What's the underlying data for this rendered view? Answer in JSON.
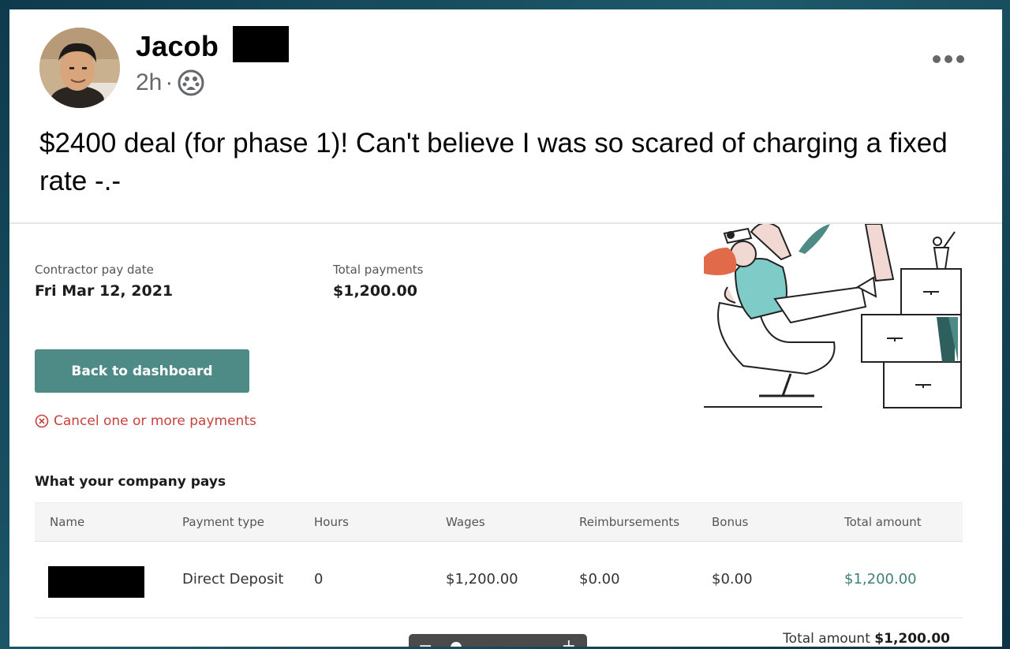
{
  "post": {
    "author": "Jacob",
    "time": "2h",
    "separator": "·",
    "audience_icon": "group-icon",
    "text": "$2400 deal (for phase 1)! Can't believe I was so scared of charging a fixed rate -.-"
  },
  "payment": {
    "pay_date_label": "Contractor pay date",
    "pay_date": "Fri Mar 12, 2021",
    "total_label": "Total payments",
    "total_value": "$1,200.00",
    "back_button": "Back to dashboard",
    "cancel_link": "Cancel one or more payments",
    "section_title": "What your company pays",
    "columns": [
      "Name",
      "Payment type",
      "Hours",
      "Wages",
      "Reimbursements",
      "Bonus",
      "Total amount"
    ],
    "row": {
      "payment_type": "Direct Deposit",
      "hours": "0",
      "wages": "$1,200.00",
      "reimbursements": "$0.00",
      "bonus": "$0.00",
      "total": "$1,200.00"
    },
    "footer_total_label": "Total amount",
    "footer_total_value": "$1,200.00"
  },
  "zoom": {
    "minus": "−",
    "plus": "+",
    "level": 0.1
  },
  "colors": {
    "accent": "#4e8a86",
    "cancel": "#c8423c",
    "teal_text": "#3f7f7c"
  }
}
